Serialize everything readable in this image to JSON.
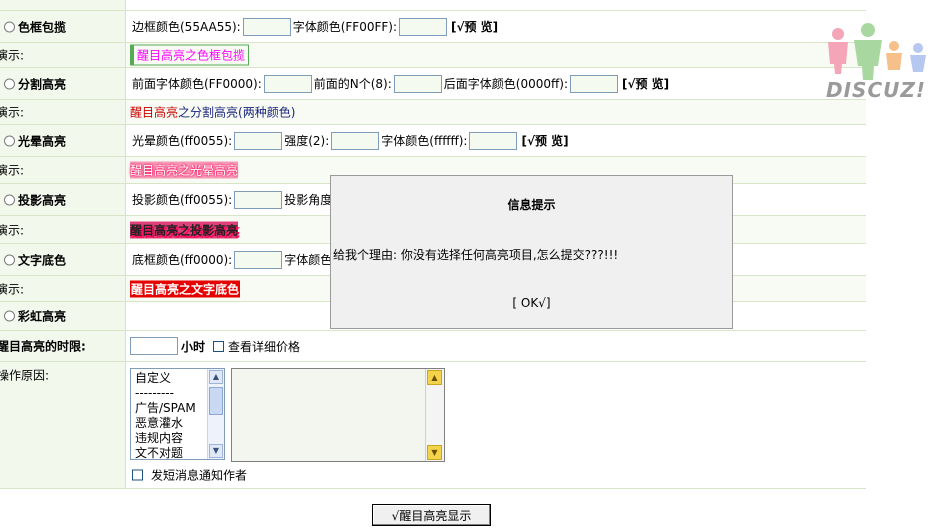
{
  "options": [
    {
      "title": "色框包揽",
      "fields": [
        "边框颜色(55AA55):",
        "字体颜色(FF00FF):"
      ],
      "preview_label": "[√预 览]",
      "demo_label": "演示:",
      "demo_text": "醒目高亮之色框包揽"
    },
    {
      "title": "分割高亮",
      "fields": [
        "前面字体颜色(FF0000):",
        "前面的N个(8):",
        "后面字体颜色(0000ff):"
      ],
      "preview_label": "[√预 览]",
      "demo_label": "演示:",
      "demo_text_a": "醒目高亮",
      "demo_text_b": "之分割高亮(两种颜色)"
    },
    {
      "title": "光晕高亮",
      "fields": [
        "光晕颜色(ff0055):",
        "强度(2):",
        "字体颜色(ffffff):"
      ],
      "preview_label": "[√预 览]",
      "demo_label": "演示:",
      "demo_text": "醒目高亮之光晕高亮"
    },
    {
      "title": "投影高亮",
      "fields": [
        "投影颜色(ff0055):",
        "投影角度"
      ],
      "demo_label": "演示:",
      "demo_text": "醒目高亮之投影高亮"
    },
    {
      "title": "文字底色",
      "fields": [
        "底框颜色(ff0000):",
        "字体颜色("
      ],
      "demo_label": "演示:",
      "demo_text": "醒目高亮之文字底色"
    },
    {
      "title": "彩虹高亮"
    }
  ],
  "duration": {
    "label": "醒目高亮的时限:",
    "unit": "小时",
    "check_label": "查看详细价格"
  },
  "reason": {
    "label": "操作原因:",
    "items": [
      "自定义",
      "---------",
      "广告/SPAM",
      "恶意灌水",
      "违规内容",
      "文不对题"
    ],
    "notify_label": "发短消息通知作者"
  },
  "submit_label": "√醒目高亮显示",
  "dialog": {
    "title": "信息提示",
    "message": "给我个理由: 你没有选择任何高亮项目,怎么提交???!!!",
    "ok_label": "[ OK√]"
  },
  "logo": {
    "text": "DISCUZ!"
  },
  "colors": {
    "lab_bg": "#f3f8ec",
    "border": "#d8e4c8"
  }
}
